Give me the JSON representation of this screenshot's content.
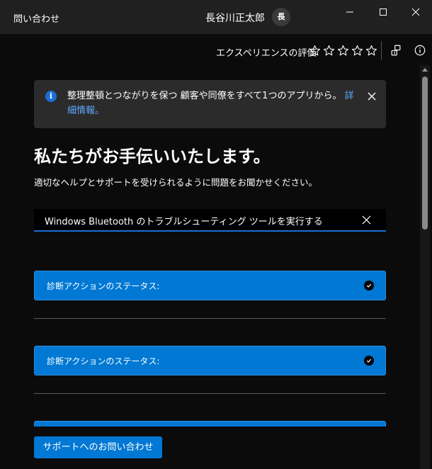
{
  "titlebar": {
    "app_title": "問い合わせ",
    "user_name": "長谷川正太郎",
    "avatar_initial": "長",
    "controls": [
      "minimize-icon",
      "maximize-icon",
      "close-icon"
    ]
  },
  "rating": {
    "label": "エクスペリエンスの評価",
    "stars_total": 5,
    "stars_selected": 0
  },
  "toolbar_icons": [
    "share-icon",
    "info-icon"
  ],
  "banner": {
    "icon": "info-icon",
    "text": "整理整頓とつながりを保つ 顧客や同僚をすべて1つのアプリから。",
    "link": "詳細情報。"
  },
  "main": {
    "heading": "私たちがお手伝いいたします。",
    "subheading": "適切なヘルプとサポートを受けられるように問題をお聞かせください。"
  },
  "search": {
    "value": "Windows Bluetooth のトラブルシューティング ツールを実行する"
  },
  "status_cards": [
    {
      "label": "診断アクションのステータス:",
      "icon": "check-circle-icon"
    },
    {
      "label": "診断アクションのステータス:",
      "icon": "check-circle-icon"
    }
  ],
  "support_button": {
    "label": "サポートへのお問い合わせ"
  },
  "colors": {
    "accent": "#0078d4",
    "link": "#60a8ff",
    "background": "#0b0b0b",
    "titlebar": "#202020",
    "banner": "#2b2b2b"
  }
}
